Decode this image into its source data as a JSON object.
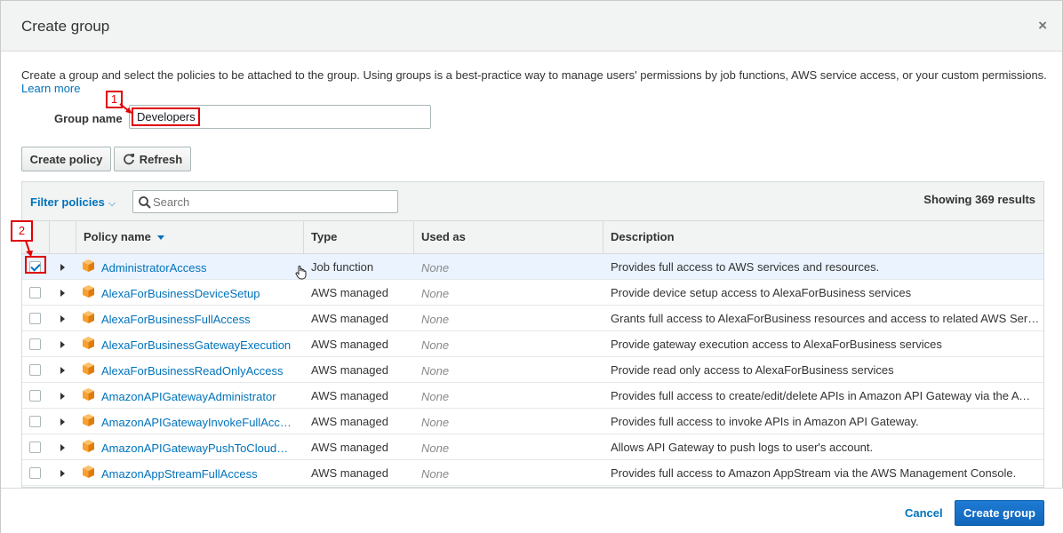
{
  "modal": {
    "title": "Create group",
    "close_glyph": "×"
  },
  "intro": {
    "text": "Create a group and select the policies to be attached to the group. Using groups is a best-practice way to manage users' permissions by job functions, AWS service access, or your custom permissions.",
    "link": "Learn more"
  },
  "group_name": {
    "label": "Group name",
    "value": "Developers"
  },
  "annotations": {
    "step1": "1",
    "step2": "2",
    "color": "#e00000"
  },
  "toolbar": {
    "create_policy": "Create policy",
    "refresh": "Refresh"
  },
  "filter": {
    "label": "Filter policies",
    "chevron": "⌵",
    "search_placeholder": "Search",
    "showing": "Showing 369 results"
  },
  "columns": {
    "policy_name": "Policy name",
    "type": "Type",
    "used_as": "Used as",
    "description": "Description"
  },
  "rows": [
    {
      "name": "AdministratorAccess",
      "type": "Job function",
      "used": "None",
      "desc": "Provides full access to AWS services and resources.",
      "checked": true
    },
    {
      "name": "AlexaForBusinessDeviceSetup",
      "type": "AWS managed",
      "used": "None",
      "desc": "Provide device setup access to AlexaForBusiness services",
      "checked": false
    },
    {
      "name": "AlexaForBusinessFullAccess",
      "type": "AWS managed",
      "used": "None",
      "desc": "Grants full access to AlexaForBusiness resources and access to related AWS Services",
      "checked": false
    },
    {
      "name": "AlexaForBusinessGatewayExecution",
      "type": "AWS managed",
      "used": "None",
      "desc": "Provide gateway execution access to AlexaForBusiness services",
      "checked": false
    },
    {
      "name": "AlexaForBusinessReadOnlyAccess",
      "type": "AWS managed",
      "used": "None",
      "desc": "Provide read only access to AlexaForBusiness services",
      "checked": false
    },
    {
      "name": "AmazonAPIGatewayAdministrator",
      "type": "AWS managed",
      "used": "None",
      "desc": "Provides full access to create/edit/delete APIs in Amazon API Gateway via the AWS Ma...",
      "checked": false
    },
    {
      "name": "AmazonAPIGatewayInvokeFullAccess",
      "type": "AWS managed",
      "used": "None",
      "desc": "Provides full access to invoke APIs in Amazon API Gateway.",
      "checked": false
    },
    {
      "name": "AmazonAPIGatewayPushToCloudWat...",
      "type": "AWS managed",
      "used": "None",
      "desc": "Allows API Gateway to push logs to user's account.",
      "checked": false
    },
    {
      "name": "AmazonAppStreamFullAccess",
      "type": "AWS managed",
      "used": "None",
      "desc": "Provides full access to Amazon AppStream via the AWS Management Console.",
      "checked": false
    }
  ],
  "footer": {
    "cancel": "Cancel",
    "create_group": "Create group"
  },
  "colors": {
    "link": "#0073bb",
    "primary": "#1a73c9",
    "aws_orange": "#f7a130"
  }
}
